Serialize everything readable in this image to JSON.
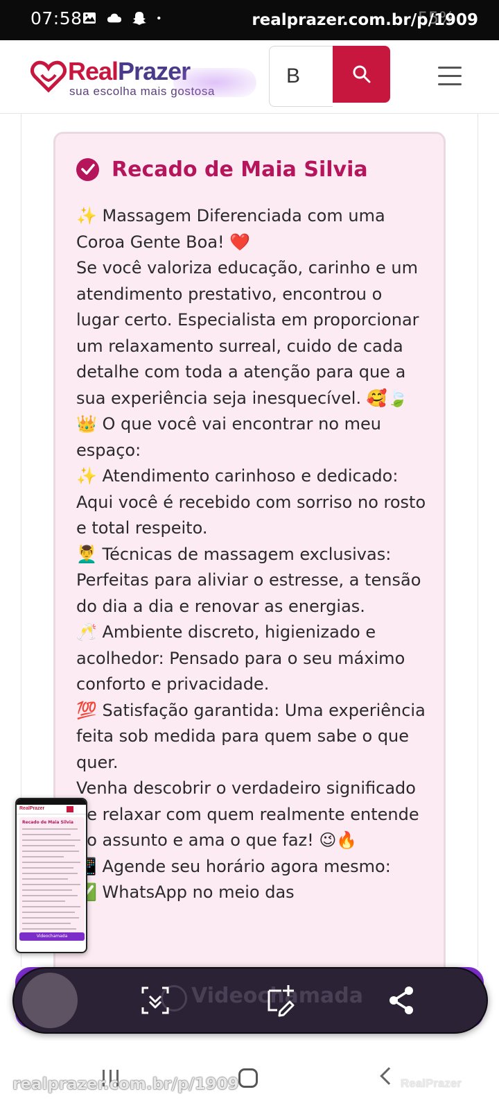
{
  "status_bar": {
    "time": "07:58",
    "url_overlay": "realprazer.com.br/p/1909",
    "battery": "55%",
    "icons": [
      "gallery-icon",
      "cloud-icon",
      "snapchat-icon",
      "dot-icon",
      "mute-icon",
      "wifi-icon",
      "signal-icon",
      "battery-icon"
    ]
  },
  "header": {
    "logo_real": "Real",
    "logo_prazer": "Prazer",
    "logo_tagline": "sua escolha mais gostosa",
    "search_value": "B",
    "search_icon": "search-icon",
    "menu_icon": "hamburger-menu-icon",
    "accent_color": "#c8173f"
  },
  "card": {
    "title": "Recado de Maia Silvia",
    "title_color": "#b4155b",
    "background": "#fcebf3",
    "paragraphs": [
      "✨ Massagem Diferenciada com uma Coroa Gente Boa! ❤️",
      "Se você valoriza educação, carinho e um atendimento prestativo, encontrou o lugar certo. Especialista em proporcionar um relaxamento surreal, cuido de cada detalhe com toda a atenção para que a sua experiência seja inesquecível. 🥰🍃",
      "👑 O que você vai encontrar no meu espaço:",
      "✨ Atendimento carinhoso e dedicado: Aqui você é recebido com sorriso no rosto e total respeito.",
      "💆‍♂️ Técnicas de massagem exclusivas: Perfeitas para aliviar o estresse, a tensão do dia a dia e renovar as energias.",
      "🥂 Ambiente discreto, higienizado e acolhedor: Pensado para o seu máximo conforto e privacidade.",
      "💯 Satisfação garantida: Uma experiência feita sob medida para quem sabe o que quer.",
      "Venha descobrir o verdadeiro significado de relaxar com quem realmente entende do assunto e ama o que faz! 😉🔥",
      "📲 Agende seu horário agora mesmo:",
      "✅ WhatsApp no meio das"
    ]
  },
  "video_call_button": {
    "label": "Videochamada",
    "color": "#7e2fd0"
  },
  "screenshot_toolbar": {
    "buttons": [
      "scroll-capture-icon",
      "crop-edit-icon",
      "share-icon"
    ]
  },
  "thumbnail": {
    "logo": "RealPrazer",
    "title": "Recado de Maia Silvia",
    "button": "Videochamada"
  },
  "nav_bar": {
    "url_overlay": "realprazer.com.br/p/1909",
    "watermark": "RealPrazer"
  }
}
